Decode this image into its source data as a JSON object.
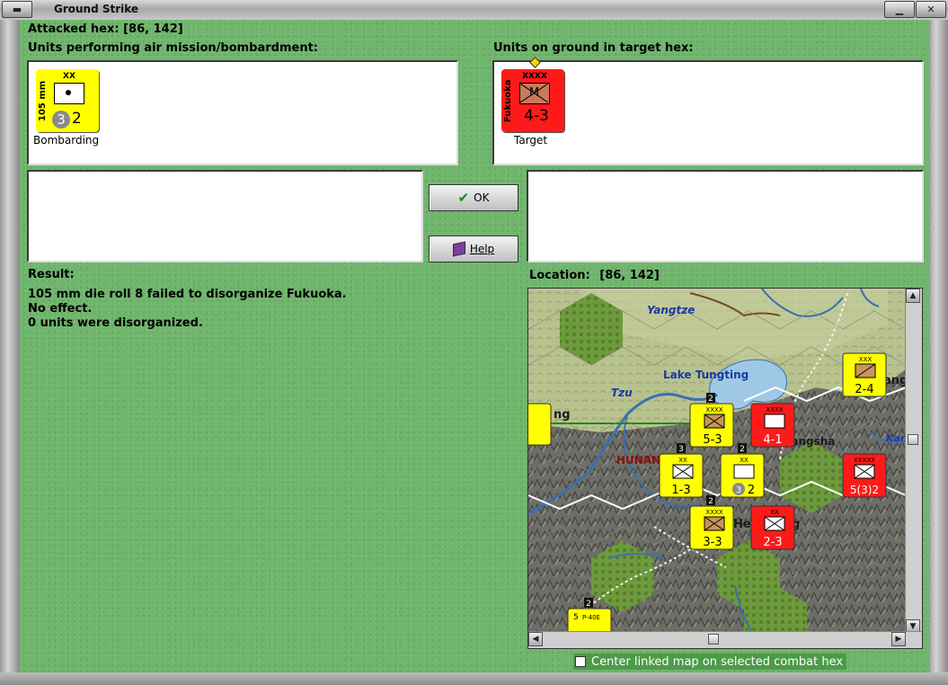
{
  "window": {
    "title": "Ground Strike"
  },
  "attacked_hex": {
    "label": "Attacked hex:",
    "value": "[86, 142]"
  },
  "air_units": {
    "heading": "Units performing air mission/bombardment:",
    "unit": {
      "name": "105 mm",
      "size": "XX",
      "factor_circle": "3",
      "factor": "2",
      "color": "#ffff00",
      "caption": "Bombarding"
    }
  },
  "ground_units": {
    "heading": "Units on ground in target hex:",
    "unit": {
      "name": "Fukuoka",
      "size": "XXXX",
      "symbol": "M",
      "factor": "4-3",
      "color": "#ff1a1a",
      "caption": "Target"
    }
  },
  "buttons": {
    "ok_label": "OK",
    "help_label": "Help",
    "ok_icon": "checkmark-icon",
    "help_icon": "book-icon"
  },
  "result": {
    "heading": "Result:",
    "lines": [
      "105 mm die roll 8 failed to disorganize Fukuoka.",
      "No effect.",
      "0 units were disorganized."
    ]
  },
  "location": {
    "label": "Location:",
    "value": "[86, 142]"
  },
  "map": {
    "labels": {
      "river_1": "Yangtze",
      "lake": "Lake Tungting",
      "river_2": "Tzu",
      "province": "HUNAN",
      "city_1": "Changsha",
      "city_2": "Hengyang",
      "partial_1": "ng",
      "partial_2": "ang",
      "partial_3": "Kan"
    },
    "units": [
      {
        "id": "u1",
        "color": "#ffff00",
        "size": "XXXX",
        "factor": "5-3",
        "stack": "2"
      },
      {
        "id": "u2",
        "color": "#ff1a1a",
        "size": "XXXX",
        "factor": "4-1",
        "stack": ""
      },
      {
        "id": "u3",
        "color": "#ffff00",
        "size": "XX",
        "factor": "1-3",
        "stack": "3"
      },
      {
        "id": "u4",
        "color": "#ffff00",
        "size": "XX",
        "factor": "2",
        "circle": "3",
        "stack": "2"
      },
      {
        "id": "u5",
        "color": "#ff1a1a",
        "size": "XXXXX",
        "factor": "5(3)2",
        "stack": ""
      },
      {
        "id": "u6",
        "color": "#ffff00",
        "size": "XXXX",
        "factor": "3-3",
        "stack": "2"
      },
      {
        "id": "u7",
        "color": "#ff1a1a",
        "size": "XX",
        "factor": "2-3",
        "stack": ""
      },
      {
        "id": "u8",
        "color": "#ffff00",
        "size": "XXX",
        "factor": "2-4",
        "stack": ""
      },
      {
        "id": "u9",
        "color": "#ffff00",
        "size": "",
        "factor": "5",
        "name": "P-40E",
        "stack": "2"
      }
    ]
  },
  "center_option": {
    "label": "Center linked map on selected combat hex",
    "checked": false
  }
}
